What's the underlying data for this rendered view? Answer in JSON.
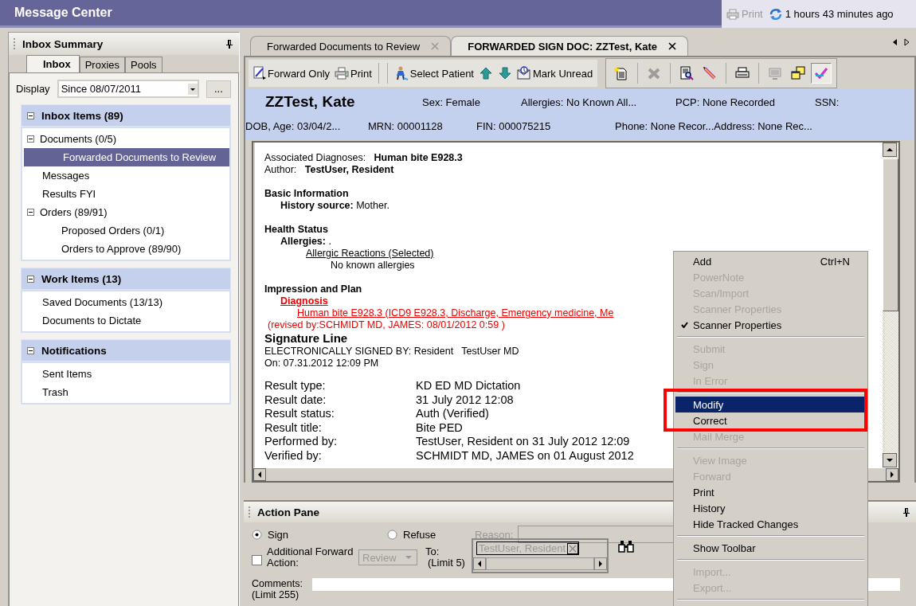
{
  "window": {
    "title": "Message Center",
    "print": "Print",
    "last_refresh": "1 hours 43 minutes ago"
  },
  "inbox_summary": {
    "title": "Inbox Summary",
    "tabs": [
      {
        "label": "Inbox",
        "selected": true
      },
      {
        "label": "Proxies",
        "selected": false
      },
      {
        "label": "Pools",
        "selected": false
      }
    ],
    "display": {
      "label": "Display",
      "value": "Since 08/07/2011",
      "more": "..."
    },
    "sections": [
      {
        "title": "Inbox Items (89)",
        "expanded": true,
        "items": [
          {
            "label": "Documents (0/5)",
            "selected": false,
            "expanded": true,
            "children": [
              {
                "label": "Forwarded Documents to Review",
                "selected": true
              }
            ]
          },
          {
            "label": "Messages",
            "selected": false
          },
          {
            "label": "Results FYI",
            "selected": false
          },
          {
            "label": "Orders (89/91)",
            "selected": false,
            "expanded": true,
            "children": [
              {
                "label": "Proposed Orders (0/1)",
                "selected": false
              },
              {
                "label": "Orders to Approve (89/90)",
                "selected": false
              }
            ]
          }
        ]
      },
      {
        "title": "Work Items (13)",
        "expanded": true,
        "items": [
          {
            "label": "Saved Documents (13/13)",
            "selected": false
          },
          {
            "label": "Documents to Dictate",
            "selected": false
          }
        ]
      },
      {
        "title": "Notifications",
        "expanded": true,
        "items": [
          {
            "label": "Sent Items",
            "selected": false
          },
          {
            "label": "Trash",
            "selected": false
          }
        ]
      }
    ]
  },
  "doc_tabs": [
    {
      "label": "Forwarded Documents to Review",
      "selected": false
    },
    {
      "label": "FORWARDED SIGN DOC: ZZTest, Kate",
      "selected": true
    }
  ],
  "toolbar": {
    "text_buttons": [
      "Forward Only",
      "Print",
      "Select Patient",
      "Mark Unread"
    ],
    "icon_buttons": [
      {
        "disabled": false,
        "pressed": false
      },
      {
        "disabled": true,
        "pressed": false
      },
      {
        "disabled": false,
        "pressed": false
      },
      {
        "disabled": false,
        "pressed": false
      },
      {
        "disabled": false,
        "pressed": false
      },
      {
        "disabled": true,
        "pressed": false
      },
      {
        "disabled": false,
        "pressed": false
      },
      {
        "disabled": false,
        "pressed": true
      }
    ]
  },
  "patient": {
    "name": "ZZTest, Kate",
    "row_1": [
      "Sex: Female",
      "Allergies: No Known All...",
      "PCP: None Recorded",
      "SSN:"
    ],
    "row_2": [
      "DOB, Age: 03/04/2...",
      "MRN: 00001128",
      "FIN: 000075215",
      "Phone: None Recor...",
      "Address: None Rec..."
    ]
  },
  "document": {
    "header_lines": [
      "Associated Diagnoses:   **Human bite E928.3**",
      "Author:   **TestUser, Resident**"
    ],
    "sections": [
      {
        "heading": "Basic Information",
        "items": [
          {
            "kind": "plain",
            "text": "**History source:** Mother."
          }
        ]
      },
      {
        "heading": "Health Status",
        "items": [
          {
            "kind": "plain",
            "text": "**Allergies:** .",
            "children": [
              {
                "kind": "underlined",
                "text": "Allergic Reactions (Selected)",
                "children": [
                  {
                    "kind": "plain",
                    "text": "No known allergies"
                  }
                ]
              }
            ]
          }
        ]
      },
      {
        "heading": "Impression and Plan",
        "items": [
          {
            "kind": "red-heading",
            "text": "Diagnosis",
            "children": [
              {
                "kind": "red-link",
                "text": "Human bite E928.3 (ICD9 E928.3, Discharge, Emergency medicine, Me"
              }
            ]
          }
        ],
        "note": "(revised by:SCHMIDT MD, JAMES: 08/01/2012 0:59 )"
      }
    ],
    "signature": {
      "title": "Signature Line",
      "lines": [
        "ELECTRONICALLY SIGNED BY: Resident   TestUser MD",
        "On: 07.31.2012 12:09 PM"
      ]
    },
    "results": [
      {
        "label": "Result type:",
        "value": "KD ED MD Dictation"
      },
      {
        "label": "Result date:",
        "value": "31 July 2012 12:08"
      },
      {
        "label": "Result status:",
        "value": "Auth (Verified)"
      },
      {
        "label": "Result title:",
        "value": "Bite PED"
      },
      {
        "label": "Performed by:",
        "value": "TestUser, Resident on 31 July 2012 12:09"
      },
      {
        "label": "Verified by:",
        "value": "SCHMIDT MD, JAMES on 01 August 2012"
      }
    ]
  },
  "action_pane": {
    "title": "Action Pane",
    "options": [
      {
        "label": "Sign",
        "selected": true
      },
      {
        "label": "Refuse",
        "selected": false
      }
    ],
    "reason": {
      "label": "Reason:",
      "disabled": true
    },
    "forward": {
      "label": "Additional Forward Action:",
      "checked": false,
      "action": "Review",
      "disabled": true,
      "to_label": "To:",
      "limit": "(Limit 5)",
      "recipients": [
        "TestUser, Resident"
      ]
    },
    "comments": {
      "label": "Comments:",
      "limit": "(Limit 255)"
    }
  },
  "context_menu": {
    "items": [
      {
        "kind": "item",
        "label": "Add",
        "shortcut": "Ctrl+N",
        "disabled": false,
        "checked": false,
        "selected": false
      },
      {
        "kind": "item",
        "label": "PowerNote",
        "disabled": true,
        "checked": false,
        "selected": false
      },
      {
        "kind": "item",
        "label": "Scan/Import",
        "disabled": true,
        "checked": false,
        "selected": false
      },
      {
        "kind": "item",
        "label": "Scanner Properties",
        "disabled": true,
        "checked": false,
        "selected": false
      },
      {
        "kind": "item",
        "label": "Scanner Properties",
        "disabled": false,
        "checked": true,
        "selected": false
      },
      {
        "kind": "separator"
      },
      {
        "kind": "item",
        "label": "Submit",
        "disabled": true,
        "checked": false,
        "selected": false
      },
      {
        "kind": "item",
        "label": "Sign",
        "disabled": true,
        "checked": false,
        "selected": false
      },
      {
        "kind": "item",
        "label": "In Error",
        "disabled": true,
        "checked": false,
        "selected": false
      },
      {
        "kind": "separator"
      },
      {
        "kind": "item",
        "label": "Modify",
        "disabled": false,
        "checked": false,
        "selected": true,
        "highlighted": true
      },
      {
        "kind": "item",
        "label": "Correct",
        "disabled": false,
        "checked": false,
        "selected": false,
        "highlighted": true
      },
      {
        "kind": "item",
        "label": "Mail Merge",
        "disabled": true,
        "checked": false,
        "selected": false
      },
      {
        "kind": "separator"
      },
      {
        "kind": "item",
        "label": "View Image",
        "disabled": true,
        "checked": false,
        "selected": false
      },
      {
        "kind": "item",
        "label": "Forward",
        "disabled": true,
        "checked": false,
        "selected": false
      },
      {
        "kind": "item",
        "label": "Print",
        "disabled": false,
        "checked": false,
        "selected": false
      },
      {
        "kind": "item",
        "label": "History",
        "disabled": false,
        "checked": false,
        "selected": false
      },
      {
        "kind": "item",
        "label": "Hide Tracked Changes",
        "disabled": false,
        "checked": false,
        "selected": false
      },
      {
        "kind": "separator"
      },
      {
        "kind": "item",
        "label": "Show Toolbar",
        "disabled": false,
        "checked": false,
        "selected": false
      },
      {
        "kind": "separator"
      },
      {
        "kind": "item",
        "label": "Import...",
        "disabled": true,
        "checked": false,
        "selected": false
      },
      {
        "kind": "item",
        "label": "Export...",
        "disabled": true,
        "checked": false,
        "selected": false
      },
      {
        "kind": "separator"
      }
    ]
  }
}
